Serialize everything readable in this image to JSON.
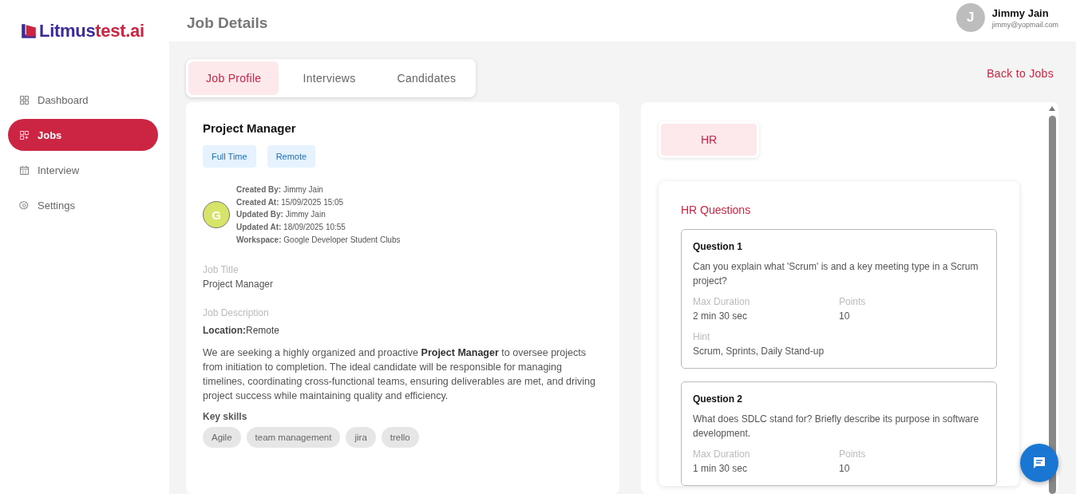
{
  "logo": {
    "part_1": "Litmus",
    "part_2": "test.ai"
  },
  "sidebar": {
    "items": [
      {
        "label": "Dashboard",
        "kind": "grid",
        "selected": false
      },
      {
        "label": "Jobs",
        "kind": "grid-plus",
        "selected": true
      },
      {
        "label": "Interview",
        "kind": "calendar",
        "selected": false
      },
      {
        "label": "Settings",
        "kind": "gear",
        "selected": false
      }
    ]
  },
  "header": {
    "title": "Job Details",
    "user": {
      "initial": "J",
      "name": "Jimmy Jain",
      "email": "jimmy@yopmail.com"
    }
  },
  "tabs": [
    {
      "label": "Job Profile",
      "selected": true
    },
    {
      "label": "Interviews",
      "selected": false
    },
    {
      "label": "Candidates",
      "selected": false
    }
  ],
  "back_link": "Back to Jobs",
  "job": {
    "title": "Project Manager",
    "tags": [
      "Full Time",
      "Remote"
    ],
    "avatar_initial": "G",
    "meta": [
      "**Created By:** Jimmy Jain",
      "**Created At:** 15/09/2025 15:05",
      "**Updated By:** Jimmy Jain",
      "**Updated At:** 18/09/2025 10:55",
      "**Workspace:** Google Developer Student Clubs"
    ],
    "job_title_label": "Job Title",
    "job_title": "Project Manager",
    "description_label": "Job Description",
    "location": "**Location:**Remote",
    "description": "We are seeking a highly organized and proactive **Project Manager** to oversee projects from initiation to completion. The ideal candidate will be responsible for managing timelines, coordinating cross-functional teams, ensuring deliverables are met, and driving project success while maintaining quality and efficiency.",
    "skills_label": "Key skills",
    "skills": [
      "Agile",
      "team management",
      "jira",
      "trello"
    ]
  },
  "rounds": {
    "tabs": [
      {
        "label": "HR",
        "selected": true
      }
    ],
    "heading": "HR Questions",
    "questions": [
      {
        "title": "Question 1",
        "text": "Can you explain what 'Scrum' is and a key meeting type in a Scrum project?",
        "fields": [
          {
            "label": "Max Duration",
            "value": "2 min 30 sec"
          },
          {
            "label": "Points",
            "value": "10"
          }
        ],
        "hint_label": "Hint",
        "hint": "Scrum, Sprints, Daily Stand-up"
      },
      {
        "title": "Question 2",
        "text": "What does SDLC stand for? Briefly describe its purpose in software development.",
        "fields": [
          {
            "label": "Max Duration",
            "value": "1 min 30 sec"
          },
          {
            "label": "Points",
            "value": "10"
          }
        ]
      }
    ]
  }
}
